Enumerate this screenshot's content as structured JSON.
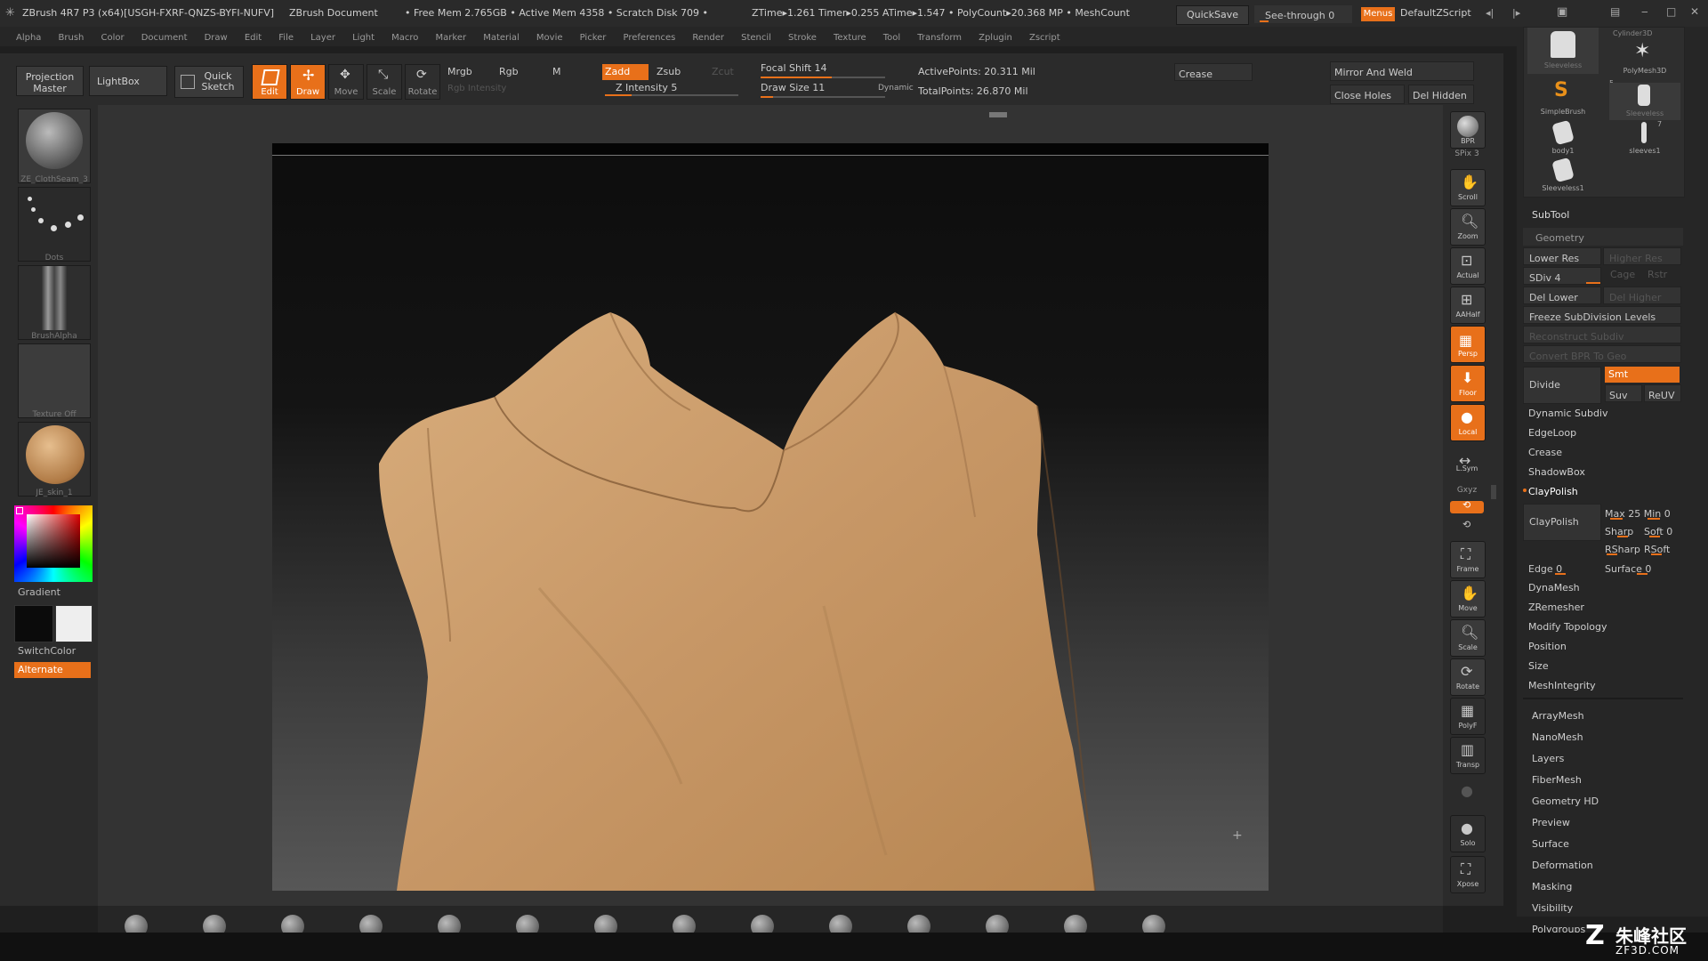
{
  "title_bar": {
    "app": "ZBrush 4R7 P3 (x64)[USGH-FXRF-QNZS-BYFI-NUFV]",
    "document": "ZBrush Document",
    "stats": "• Free Mem 2.765GB • Active Mem 4358 • Scratch Disk 709 •",
    "timing": "ZTime▸1.261 Timer▸0.255 ATime▸1.547 • PolyCount▸20.368 MP • MeshCount",
    "quicksave": "QuickSave",
    "seethrough": "See-through 0",
    "menus": "Menus",
    "zscript": "DefaultZScript"
  },
  "menu_bar": [
    "Alpha",
    "Brush",
    "Color",
    "Document",
    "Draw",
    "Edit",
    "File",
    "Layer",
    "Light",
    "Macro",
    "Marker",
    "Material",
    "Movie",
    "Picker",
    "Preferences",
    "Render",
    "Stencil",
    "Stroke",
    "Texture",
    "Tool",
    "Transform",
    "Zplugin",
    "Zscript"
  ],
  "toolbar": {
    "projection_master": "Projection Master",
    "lightbox": "LightBox",
    "quick_sketch": "Quick Sketch",
    "edit": "Edit",
    "draw": "Draw",
    "move": "Move",
    "scale": "Scale",
    "rotate": "Rotate",
    "mrgb": "Mrgb",
    "rgb": "Rgb",
    "m": "M",
    "rgb_intensity": "Rgb Intensity",
    "zadd": "Zadd",
    "zsub": "Zsub",
    "zcut": "Zcut",
    "z_intensity": "Z Intensity 5",
    "z_intensity_level": 0.2,
    "focal_shift": "Focal Shift 14",
    "focal_shift_level": 0.57,
    "draw_size": "Draw Size 11",
    "draw_size_level": 0.1,
    "dynamic": "Dynamic",
    "active_points": "ActivePoints: 20.311 Mil",
    "total_points": "TotalPoints: 26.870 Mil",
    "crease": "Crease",
    "mirror_weld": "Mirror And Weld",
    "close_holes": "Close Holes",
    "del_hidden": "Del Hidden"
  },
  "left_shelf": {
    "brush_label": "ZE_ClothSeam_3",
    "stroke_label": "Dots",
    "alpha_label": "BrushAlpha",
    "texture_label": "Texture Off",
    "material_label": "JE_skin_1",
    "gradient": "Gradient",
    "switch_color": "SwitchColor",
    "alternate": "Alternate"
  },
  "right_shelf": [
    "BPR",
    "SPix 3",
    "Scroll",
    "Zoom",
    "Actual",
    "AAHalf",
    "Persp",
    "Floor",
    "Local",
    "L.Sym",
    "Gxyz",
    "",
    "",
    "Frame",
    "Move",
    "Scale",
    "Rotate",
    "PolyF",
    "Transp",
    "",
    "Solo",
    "Xpose"
  ],
  "right_panel": {
    "subtool_thumbs": [
      {
        "label": "Sleeveless"
      },
      {
        "label": "Cylinder3D"
      },
      {
        "label": "PolyMesh3D"
      },
      {
        "label": "SimpleBrush"
      },
      {
        "label": "Sleeveless"
      },
      {
        "label": "body1"
      },
      {
        "label": "sleeves1"
      },
      {
        "label": "Sleeveless1"
      }
    ],
    "subtool_badges": [
      "5",
      "7"
    ],
    "subtool": "SubTool",
    "geometry": "Geometry",
    "lower_res": "Lower Res",
    "higher_res": "Higher Res",
    "sdiv": "SDiv 4",
    "cage": "Cage",
    "rstr": "Rstr",
    "del_lower": "Del Lower",
    "del_higher": "Del Higher",
    "freeze": "Freeze SubDivision Levels",
    "reconstruct": "Reconstruct Subdiv",
    "convert_bpr": "Convert BPR To Geo",
    "divide": "Divide",
    "smt": "Smt",
    "suv": "Suv",
    "reuv": "ReUV",
    "dynamic_subdiv": "Dynamic Subdiv",
    "edgeloop": "EdgeLoop",
    "crease": "Crease",
    "shadowbox": "ShadowBox",
    "claypolish": "ClayPolish",
    "claypolish_btn": "ClayPolish",
    "max_min": "Max 25 Min 0",
    "sharp": "Sharp",
    "soft": "Soft 0",
    "rsharp": "RSharp",
    "rsoft": "RSoft",
    "edge": "Edge 0",
    "surface": "Surface 0",
    "dynamesh": "DynaMesh",
    "zremesher": "ZRemesher",
    "modify_topology": "Modify Topology",
    "position": "Position",
    "size": "Size",
    "meshintegrity": "MeshIntegrity",
    "menus": [
      "ArrayMesh",
      "NanoMesh",
      "Layers",
      "FiberMesh",
      "Geometry HD",
      "Preview",
      "Surface",
      "Deformation",
      "Masking",
      "Visibility",
      "Polygroups"
    ]
  },
  "watermark": {
    "text1": "朱峰社区",
    "text2": "ZF3D.COM"
  },
  "colors": {
    "accent": "#e8701a",
    "cloth": "#c99a6a",
    "panel": "#2b2b2b"
  }
}
